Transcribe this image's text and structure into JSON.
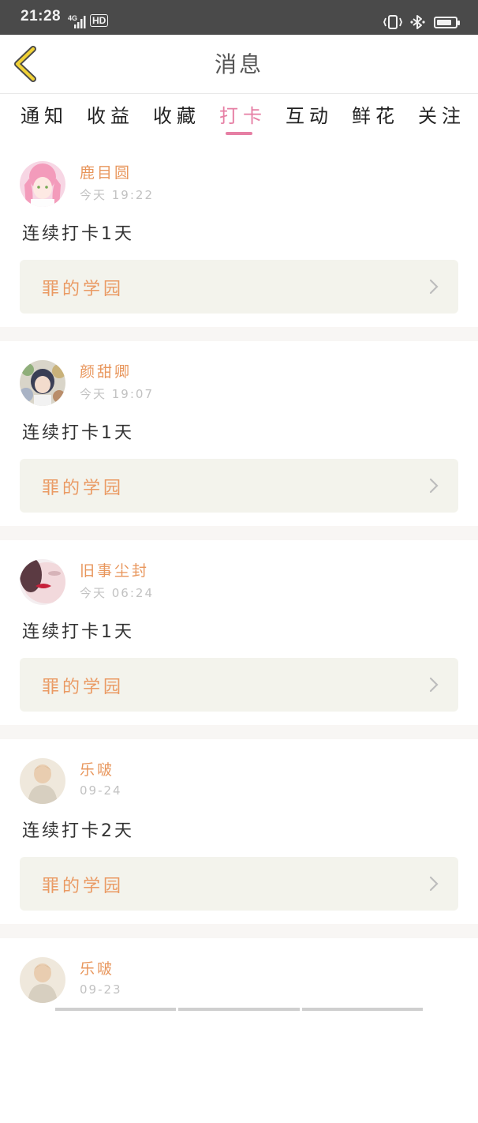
{
  "status_bar": {
    "time": "21:28",
    "network": "4G",
    "hd_label": "HD",
    "battery_level": 0.8
  },
  "header": {
    "title": "消息"
  },
  "tabs": [
    {
      "label": "通知",
      "active": false
    },
    {
      "label": "收益",
      "active": false
    },
    {
      "label": "收藏",
      "active": false
    },
    {
      "label": "打卡",
      "active": true
    },
    {
      "label": "互动",
      "active": false
    },
    {
      "label": "鲜花",
      "active": false
    },
    {
      "label": "关注",
      "active": false
    }
  ],
  "colors": {
    "accent_pink": "#e67fa4",
    "name_orange": "#e8965c",
    "card_bg": "#f3f3ec"
  },
  "items": [
    {
      "name": "鹿目圆",
      "time": "今天 19:22",
      "content": "连续打卡1天",
      "link": "罪的学园"
    },
    {
      "name": "颜甜卿",
      "time": "今天 19:07",
      "content": "连续打卡1天",
      "link": "罪的学园"
    },
    {
      "name": "旧事尘封",
      "time": "今天 06:24",
      "content": "连续打卡1天",
      "link": "罪的学园"
    },
    {
      "name": "乐啵",
      "time": "09-24",
      "content": "连续打卡2天",
      "link": "罪的学园"
    },
    {
      "name": "乐啵",
      "time": "09-23",
      "content": "",
      "link": ""
    }
  ]
}
